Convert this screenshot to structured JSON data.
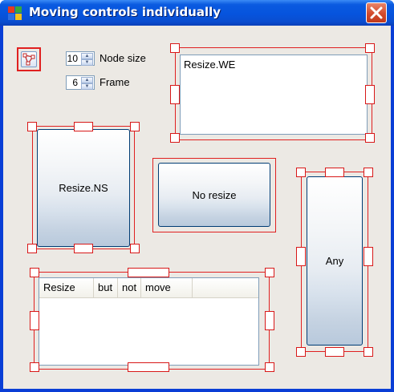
{
  "window": {
    "title": "Moving controls individually",
    "icon": "app-icon",
    "close_icon": "close-icon"
  },
  "toolbar": {
    "tool_icon": "node-graph-icon"
  },
  "settings": {
    "node_size": {
      "value": "10",
      "label": "Node size"
    },
    "frame": {
      "value": "6",
      "label": "Frame"
    }
  },
  "controls": {
    "textbox_text": "Resize.WE",
    "resize_ns_label": "Resize.NS",
    "no_resize_label": "No resize",
    "any_label": "Any"
  },
  "listview": {
    "columns": [
      "Resize",
      "but",
      "not",
      "move"
    ]
  },
  "colors": {
    "title_bar": "#0654dd",
    "client_bg": "#ece9e4",
    "selection_frame": "#e02020",
    "close_button": "#d24a2c"
  }
}
